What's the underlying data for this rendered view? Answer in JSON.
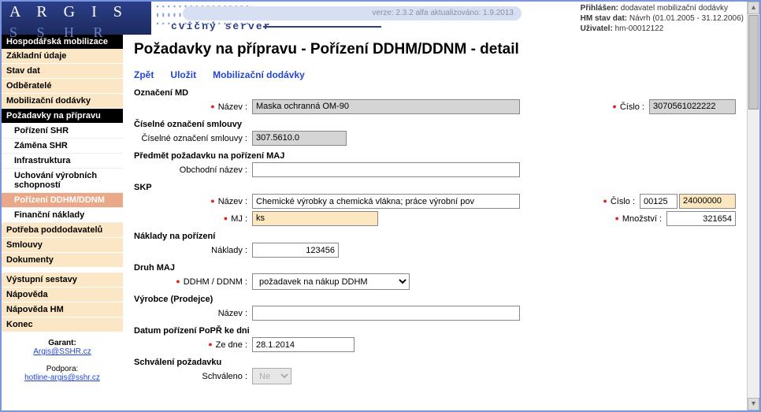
{
  "header": {
    "logo_top": "A R G I S",
    "logo_sub": "S S H R",
    "version": "verze: 2.3.2 alfa aktualizováno: 1.9.2013",
    "cvicny": "cvičný server"
  },
  "userinfo": {
    "login_lbl": "Přihlášen:",
    "login_val": "dodavatel mobilizační dodávky",
    "hm_lbl": "HM stav dat:",
    "hm_val": "Návrh (01.01.2005 - 31.12.2006)",
    "user_lbl": "Uživatel:",
    "user_val": "hm-00012122"
  },
  "sidebar": {
    "hdr1": "Hospodářská mobilizace",
    "i_zakladni": "Základní údaje",
    "i_stav": "Stav dat",
    "i_odberatele": "Odběratelé",
    "i_mobdod": "Mobilizační dodávky",
    "i_pozadavky": "Požadavky na přípravu",
    "s_porizeni_shr": "Pořízení SHR",
    "s_zamena": "Záměna SHR",
    "s_infra": "Infrastruktura",
    "s_uchovani": "Uchování výrobních schopností",
    "s_porizeni_ddhm": "Pořízení DDHM/DDNM",
    "s_financni": "Finanční náklady",
    "i_potreba": "Potřeba poddodavatelů",
    "i_smlouvy": "Smlouvy",
    "i_dokumenty": "Dokumenty",
    "i_vystupni": "Výstupní sestavy",
    "i_napoveda": "Nápověda",
    "i_napoveda_hm": "Nápověda HM",
    "i_konec": "Konec",
    "garant_lbl": "Garant:",
    "garant_link": "Argis@SSHR.cz",
    "podpora_lbl": "Podpora:",
    "podpora_link": "hotline-argis@sshr.cz"
  },
  "page": {
    "title": "Požadavky na přípravu - Pořízení DDHM/DDNM - detail",
    "actions": {
      "zpet": "Zpět",
      "ulozit": "Uložit",
      "mobdod": "Mobilizační dodávky"
    },
    "sec_oznaceni": "Označení MD",
    "lbl_nazev": "Název :",
    "val_nazev": "Maska ochranná OM-90",
    "lbl_cislo": "Číslo :",
    "val_cislo": "3070561022222",
    "sec_cisml": "Číselné označení smlouvy",
    "lbl_cisml": "Číselné označení smlouvy :",
    "val_cisml": "307.5610.0",
    "sec_predmet": "Předmět požadavku na pořízení MAJ",
    "lbl_obchnazev": "Obchodní název :",
    "val_obchnazev": "",
    "sec_skp": "SKP",
    "lbl_skp_nazev": "Název :",
    "val_skp_nazev": "Chemické výrobky a chemická vlákna; práce výrobní pov",
    "lbl_skp_cislo": "Číslo :",
    "val_skp_cislo1": "00125",
    "val_skp_cislo2": "24000000",
    "lbl_mj": "MJ :",
    "val_mj": "ks",
    "lbl_mnozstvi": "Množství :",
    "val_mnozstvi": "321654",
    "sec_naklady": "Náklady na pořízení",
    "lbl_naklady": "Náklady :",
    "val_naklady": "123456",
    "sec_druh": "Druh MAJ",
    "lbl_ddhm": "DDHM / DDNM :",
    "val_ddhm": "požadavek na nákup DDHM",
    "sec_vyrobce": "Výrobce (Prodejce)",
    "lbl_vyr_nazev": "Název :",
    "val_vyr_nazev": "",
    "sec_datum": "Datum pořízení PoPŘ ke dni",
    "lbl_zedne": "Ze dne :",
    "val_zedne": "28.1.2014",
    "sec_schvaleni": "Schválení požadavku",
    "lbl_schvaleno": "Schváleno :",
    "val_schvaleno": "Ne"
  }
}
